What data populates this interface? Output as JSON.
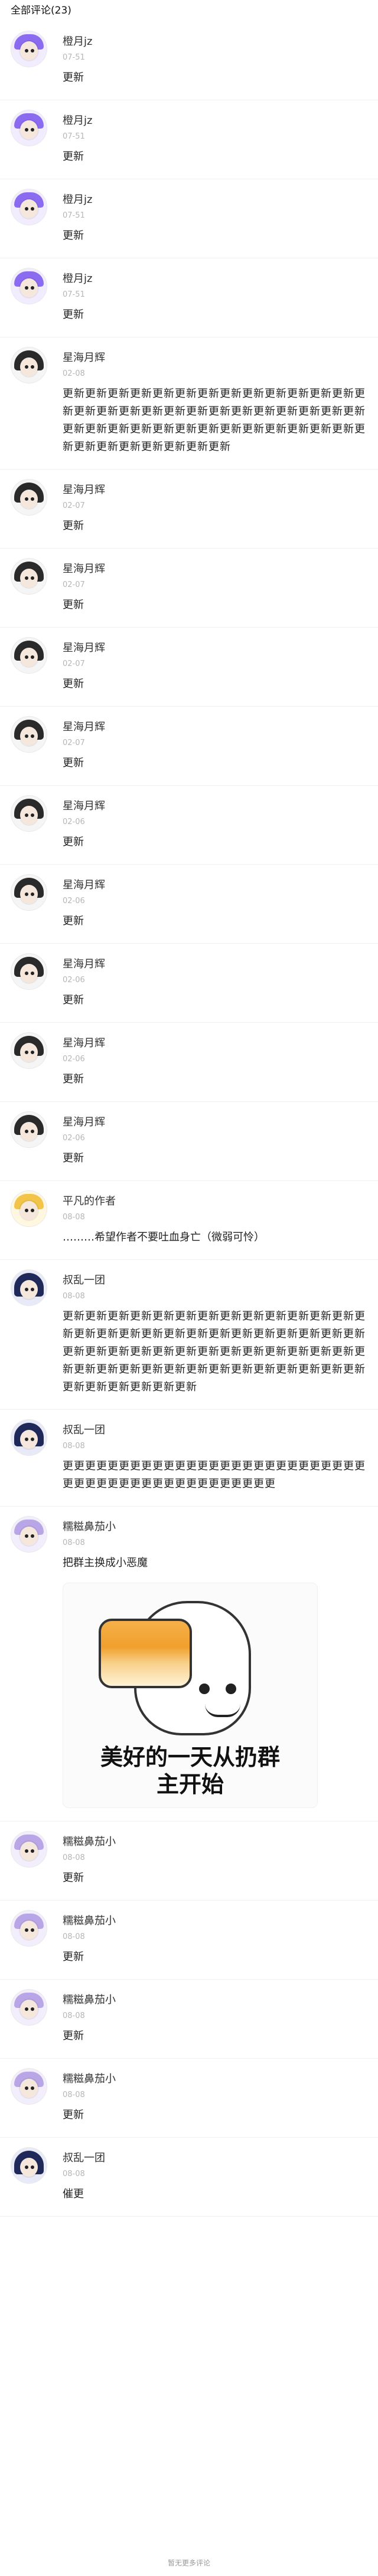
{
  "header": {
    "title": "全部评论(23)"
  },
  "comments": [
    {
      "name": "橙月jz",
      "time": "07-51",
      "text": "更新",
      "avatar": "purple"
    },
    {
      "name": "橙月jz",
      "time": "07-51",
      "text": "更新",
      "avatar": "purple"
    },
    {
      "name": "橙月jz",
      "time": "07-51",
      "text": "更新",
      "avatar": "purple"
    },
    {
      "name": "橙月jz",
      "time": "07-51",
      "text": "更新",
      "avatar": "purple"
    },
    {
      "name": "星海月辉",
      "time": "02-08",
      "text": "更新更新更新更新更新更新更新更新更新更新更新更新更新更新更新更新更新更新更新更新更新更新更新更新更新更新更新更新更新更新更新更新更新更新更新更新更新更新更新更新更新更新更新更新更新更新更新更新",
      "long": true,
      "avatar": "dark"
    },
    {
      "name": "星海月辉",
      "time": "02-07",
      "text": "更新",
      "avatar": "dark"
    },
    {
      "name": "星海月辉",
      "time": "02-07",
      "text": "更新",
      "avatar": "dark"
    },
    {
      "name": "星海月辉",
      "time": "02-07",
      "text": "更新",
      "avatar": "dark"
    },
    {
      "name": "星海月辉",
      "time": "02-07",
      "text": "更新",
      "avatar": "dark"
    },
    {
      "name": "星海月辉",
      "time": "02-06",
      "text": "更新",
      "avatar": "dark"
    },
    {
      "name": "星海月辉",
      "time": "02-06",
      "text": "更新",
      "avatar": "dark"
    },
    {
      "name": "星海月辉",
      "time": "02-06",
      "text": "更新",
      "avatar": "dark"
    },
    {
      "name": "星海月辉",
      "time": "02-06",
      "text": "更新",
      "avatar": "dark"
    },
    {
      "name": "星海月辉",
      "time": "02-06",
      "text": "更新",
      "avatar": "dark"
    },
    {
      "name": "平凡的作者",
      "time": "08-08",
      "text": "………希望作者不要吐血身亡（微弱可怜）",
      "avatar": "yellow"
    },
    {
      "name": "叔乱一团",
      "time": "08-08",
      "text": "更新更新更新更新更新更新更新更新更新更新更新更新更新更新更新更新更新更新更新更新更新更新更新更新更新更新更新更新更新更新更新更新更新更新更新更新更新更新更新更新更新更新更新更新更新更新更新更新更新更新更新更新更新更新更新更新更新更新更新更新",
      "long": true,
      "avatar": "navy"
    },
    {
      "name": "叔乱一团",
      "time": "08-08",
      "text": "更更更更更更更更更更更更更更更更更更更更更更更更更更更更更更更更更更更更更更更更更更更更更更",
      "long": true,
      "avatar": "navy"
    },
    {
      "name": "糯糍鼻茄小",
      "time": "08-08",
      "text": "把群主换成小恶魔",
      "avatar": "lavender",
      "sticker": {
        "caption_line1": "美好的一天从扔群",
        "caption_line2": "主开始"
      }
    },
    {
      "name": "糯糍鼻茄小",
      "time": "08-08",
      "text": "更新",
      "avatar": "lavender"
    },
    {
      "name": "糯糍鼻茄小",
      "time": "08-08",
      "text": "更新",
      "avatar": "lavender"
    },
    {
      "name": "糯糍鼻茄小",
      "time": "08-08",
      "text": "更新",
      "avatar": "lavender"
    },
    {
      "name": "糯糍鼻茄小",
      "time": "08-08",
      "text": "更新",
      "avatar": "lavender"
    },
    {
      "name": "叔乱一团",
      "time": "08-08",
      "text": "催更",
      "avatar": "navy"
    }
  ],
  "footer": {
    "text": "暂无更多评论"
  }
}
